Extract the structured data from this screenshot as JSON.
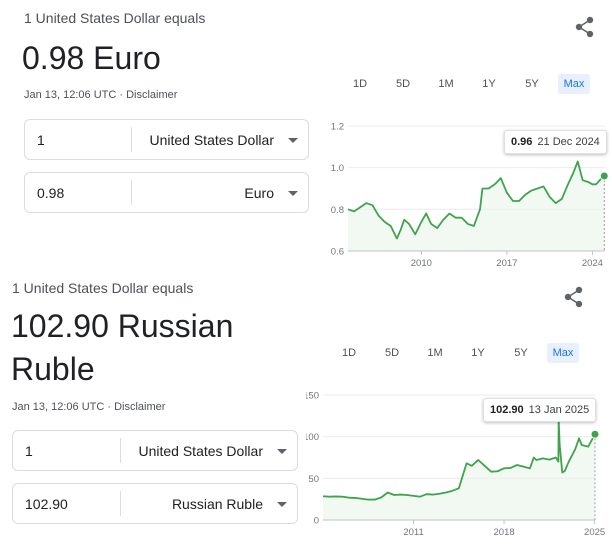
{
  "colors": {
    "line": "#3fa34d",
    "fill": "#e8f5ea",
    "accent": "#1a73e8",
    "axis": "#9aa0a6"
  },
  "euro": {
    "subtitle": "1 United States Dollar equals",
    "result": "0.98 Euro",
    "meta": "Jan 13, 12:06 UTC · Disclaimer",
    "share_icon": "share-icon",
    "ranges": [
      "1D",
      "5D",
      "1M",
      "1Y",
      "5Y",
      "Max"
    ],
    "selected_range": "Max",
    "from_amount": "1",
    "from_currency": "United States Dollar",
    "to_amount": "0.98",
    "to_currency": "Euro",
    "tooltip_value": "0.96",
    "tooltip_date": "21 Dec 2024"
  },
  "ruble": {
    "subtitle": "1 United States Dollar equals",
    "result_line1": "102.90 Russian",
    "result_line2": "Ruble",
    "meta": "Jan 13, 12:06 UTC · Disclaimer",
    "share_icon": "share-icon",
    "ranges": [
      "1D",
      "5D",
      "1M",
      "1Y",
      "5Y",
      "Max"
    ],
    "selected_range": "Max",
    "from_amount": "1",
    "from_currency": "United States Dollar",
    "to_amount": "102.90",
    "to_currency": "Russian Ruble",
    "tooltip_value": "102.90",
    "tooltip_date": "13 Jan 2025"
  },
  "chart_data": [
    {
      "type": "area",
      "series": [
        {
          "values": []
        }
      ],
      "x": [
        2004.0,
        2004.5,
        2005.0,
        2005.5,
        2006.0,
        2006.5,
        2007.0,
        2007.5,
        2008.0,
        2008.3,
        2008.6,
        2009.0,
        2009.5,
        2010.0,
        2010.4,
        2010.8,
        2011.3,
        2011.8,
        2012.3,
        2012.8,
        2013.3,
        2013.8,
        2014.3,
        2014.8,
        2015.0,
        2015.5,
        2016.0,
        2016.5,
        2017.0,
        2017.5,
        2018.0,
        2018.5,
        2019.0,
        2019.5,
        2020.0,
        2020.5,
        2021.0,
        2021.5,
        2022.0,
        2022.4,
        2022.8,
        2023.2,
        2023.7,
        2024.0,
        2024.3,
        2024.6,
        2024.97,
        2025.03
      ],
      "y": [
        0.8,
        0.79,
        0.81,
        0.83,
        0.82,
        0.77,
        0.74,
        0.72,
        0.66,
        0.7,
        0.75,
        0.73,
        0.68,
        0.74,
        0.78,
        0.73,
        0.71,
        0.75,
        0.78,
        0.76,
        0.76,
        0.73,
        0.72,
        0.8,
        0.9,
        0.9,
        0.92,
        0.95,
        0.88,
        0.84,
        0.84,
        0.87,
        0.89,
        0.9,
        0.91,
        0.86,
        0.83,
        0.85,
        0.92,
        0.97,
        1.03,
        0.94,
        0.93,
        0.92,
        0.92,
        0.94,
        0.96,
        0.96
      ],
      "xticks": [
        {
          "v": 2010,
          "label": "2010"
        },
        {
          "v": 2017,
          "label": "2017"
        },
        {
          "v": 2024,
          "label": "2024"
        }
      ],
      "yticks": [
        {
          "v": 0.6,
          "label": "0.6"
        },
        {
          "v": 0.8,
          "label": "0.8"
        },
        {
          "v": 1.0,
          "label": "1.0"
        },
        {
          "v": 1.2,
          "label": "1.2"
        }
      ],
      "xlim": [
        2004.0,
        2025.03
      ],
      "ylim": [
        0.6,
        1.2
      ],
      "highlight": {
        "x": 2024.97,
        "y": 0.96
      }
    },
    {
      "type": "area",
      "series": [
        {
          "values": []
        }
      ],
      "x": [
        2004.0,
        2004.5,
        2005.0,
        2005.5,
        2006.0,
        2006.5,
        2007.0,
        2007.5,
        2008.0,
        2008.5,
        2009.0,
        2009.5,
        2010.0,
        2010.5,
        2011.0,
        2011.5,
        2012.0,
        2012.5,
        2013.0,
        2013.5,
        2014.0,
        2014.5,
        2014.9,
        2015.1,
        2015.5,
        2016.0,
        2016.5,
        2017.0,
        2017.5,
        2018.0,
        2018.5,
        2019.0,
        2019.5,
        2020.0,
        2020.3,
        2020.5,
        2021.0,
        2021.5,
        2022.0,
        2022.2,
        2022.22,
        2022.3,
        2022.5,
        2022.7,
        2023.0,
        2023.5,
        2023.8,
        2024.0,
        2024.5,
        2025.03
      ],
      "y": [
        28.5,
        28.0,
        28.3,
        28.0,
        26.8,
        26.5,
        25.5,
        24.5,
        24.5,
        27.0,
        33.0,
        30.0,
        30.5,
        30.0,
        29.0,
        28.0,
        31.0,
        30.5,
        31.5,
        33.0,
        35.0,
        38.0,
        58.0,
        68.0,
        65.0,
        72.0,
        65.0,
        58.0,
        58.5,
        62.0,
        62.5,
        66.0,
        64.0,
        62.0,
        75.0,
        72.0,
        74.0,
        72.5,
        75.0,
        70.0,
        120.0,
        90.0,
        57.0,
        59.0,
        70.0,
        85.0,
        98.0,
        90.0,
        88.0,
        102.9
      ],
      "xticks": [
        {
          "v": 2011,
          "label": "2011"
        },
        {
          "v": 2018,
          "label": "2018"
        },
        {
          "v": 2025,
          "label": "2025"
        }
      ],
      "yticks": [
        {
          "v": 0,
          "label": "0"
        },
        {
          "v": 50,
          "label": "50"
        },
        {
          "v": 100,
          "label": "100"
        },
        {
          "v": 150,
          "label": "150"
        }
      ],
      "xlim": [
        2004.0,
        2025.03
      ],
      "ylim": [
        0,
        150
      ],
      "highlight": {
        "x": 2025.03,
        "y": 102.9
      }
    }
  ]
}
